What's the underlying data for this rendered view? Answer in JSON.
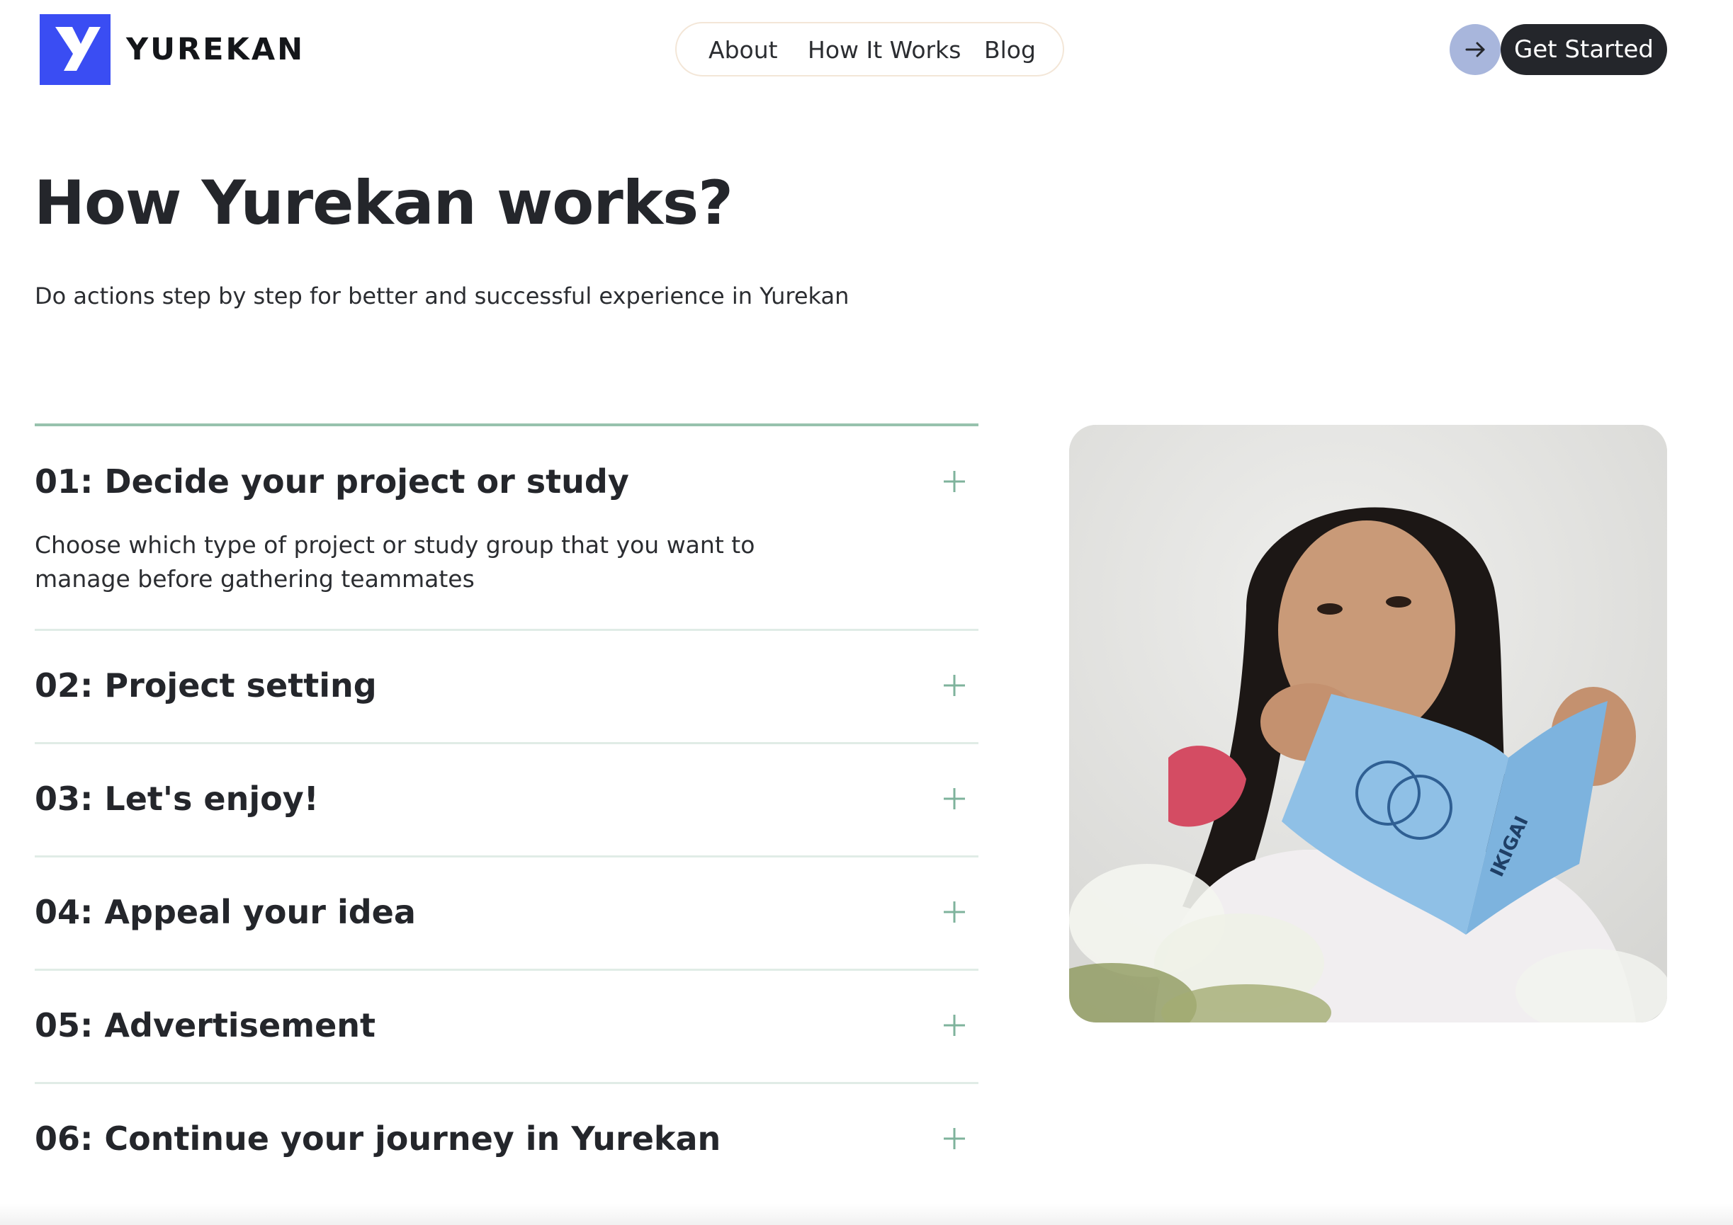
{
  "header": {
    "brand": "YUREKAN",
    "logo_icon": "yurekan-y-logo",
    "nav": [
      {
        "label": "About"
      },
      {
        "label": "How It Works"
      },
      {
        "label": "Blog"
      }
    ],
    "cta_icon": "arrow-right-icon",
    "cta_label": "Get Started"
  },
  "hero": {
    "title": "How Yurekan works?",
    "subtitle": "Do actions step by step for better and successful experience in Yurekan"
  },
  "steps": [
    {
      "title": "01: Decide your project or study",
      "expanded": true,
      "body": "Choose which type of project or study group that you want to manage before gathering teammates"
    },
    {
      "title": "02: Project setting",
      "expanded": false
    },
    {
      "title": "03: Let's enjoy!",
      "expanded": false
    },
    {
      "title": "04: Appeal your idea",
      "expanded": false
    },
    {
      "title": "05: Advertisement",
      "expanded": false
    },
    {
      "title": "06: Continue your journey in Yurekan",
      "expanded": false
    }
  ],
  "photo": {
    "subject": "woman-reading-book-photo",
    "book_title": "IKIGAI"
  },
  "colors": {
    "brand_blue": "#3a4df3",
    "dark": "#24262b",
    "accent_green": "#97c2ad",
    "divider": "#e0ece6",
    "arrow_circle": "#a8b6dc",
    "nav_border": "#f3e6d7"
  }
}
